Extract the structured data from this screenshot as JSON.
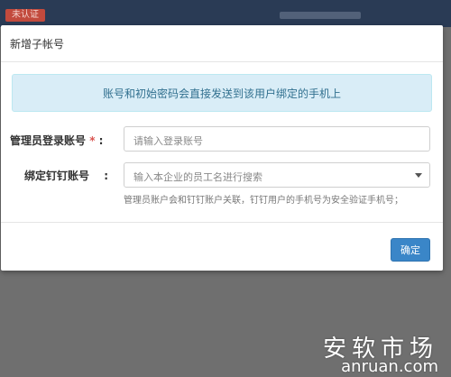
{
  "topbar": {
    "tag_text": "未认证"
  },
  "dialog": {
    "title": "新增子帐号",
    "info": "账号和初始密码会直接发送到该用户绑定的手机上",
    "fields": {
      "admin_account": {
        "label": "管理员登录账号",
        "required_mark": "*",
        "colon": ":",
        "placeholder": "请输入登录账号"
      },
      "dingtalk_account": {
        "label": "绑定钉钉账号",
        "colon": ":",
        "placeholder": "输入本企业的员工名进行搜索",
        "help": "管理员账户会和钉钉账户关联，钉钉用户的手机号为安全验证手机号；"
      }
    },
    "confirm_label": "确定"
  },
  "watermark": {
    "line1": "安软市场",
    "line2": "anruan.com"
  }
}
